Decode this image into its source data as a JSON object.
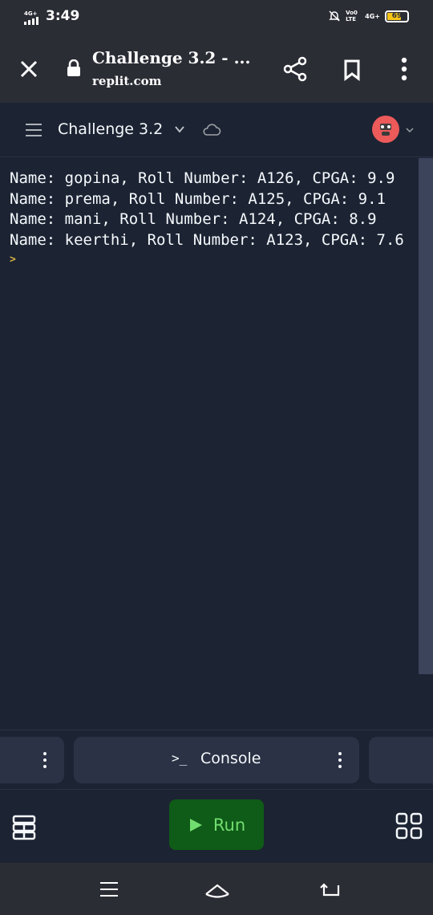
{
  "status_bar": {
    "network": "4G+",
    "time": "3:49",
    "volte": "Vo0 LTE",
    "network_right": "4G+",
    "battery": "69"
  },
  "browser": {
    "page_title": "Challenge 3.2 - ...",
    "host": "replit.com"
  },
  "repl": {
    "name": "Challenge 3.2"
  },
  "console": {
    "lines": [
      "Name: gopina, Roll Number: A126, CPGA: 9.9",
      "Name: prema, Roll Number: A125, CPGA: 9.1",
      "Name: mani, Roll Number: A124, CPGA: 8.9",
      "Name: keerthi, Roll Number: A123, CPGA: 7.6"
    ],
    "prompt": ">"
  },
  "tabs": {
    "console_glyph": ">_",
    "console_label": "Console"
  },
  "actions": {
    "run_label": "Run"
  },
  "colors": {
    "background": "#1c2333",
    "surface": "#2b3245",
    "run_button": "#0f5b18",
    "run_text": "#72dd6f",
    "prompt": "#d6b142",
    "avatar": "#ec5a5a"
  }
}
